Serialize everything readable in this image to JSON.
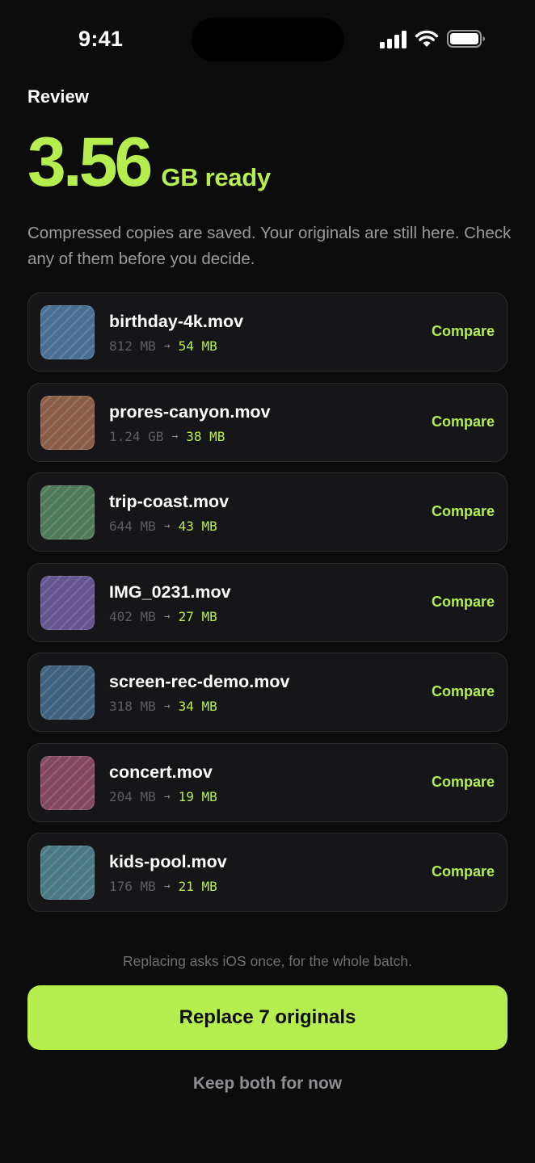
{
  "status_bar": {
    "time": "9:41"
  },
  "header": {
    "label": "Review",
    "amount": "3.56",
    "unit_text": "GB ready",
    "description": "Compressed copies are saved. Your originals are still here. Check any of them before you decide."
  },
  "items": [
    {
      "name": "birthday-4k.mov",
      "before": "812 MB",
      "after": "54 MB",
      "action": "Compare",
      "color": "#4a6f95"
    },
    {
      "name": "prores-canyon.mov",
      "before": "1.24 GB",
      "after": "38 MB",
      "action": "Compare",
      "color": "#8a5d48"
    },
    {
      "name": "trip-coast.mov",
      "before": "644 MB",
      "after": "43 MB",
      "action": "Compare",
      "color": "#4f7a57"
    },
    {
      "name": "IMG_0231.mov",
      "before": "402 MB",
      "after": "27 MB",
      "action": "Compare",
      "color": "#64548f"
    },
    {
      "name": "screen-rec-demo.mov",
      "before": "318 MB",
      "after": "34 MB",
      "action": "Compare",
      "color": "#3e6280"
    },
    {
      "name": "concert.mov",
      "before": "204 MB",
      "after": "19 MB",
      "action": "Compare",
      "color": "#84485e"
    },
    {
      "name": "kids-pool.mov",
      "before": "176 MB",
      "after": "21 MB",
      "action": "Compare",
      "color": "#4a7984"
    }
  ],
  "footer": {
    "note": "Replacing asks iOS once, for the whole batch.",
    "primary_label": "Replace 7 originals",
    "secondary_label": "Keep both for now"
  },
  "colors": {
    "accent": "#b5ee4e",
    "background": "#0c0c0d",
    "card": "#161618"
  },
  "icons": {
    "signal": "cellular-signal-icon",
    "wifi": "wifi-icon",
    "battery": "battery-icon",
    "arrow": "arrow-right-icon"
  }
}
